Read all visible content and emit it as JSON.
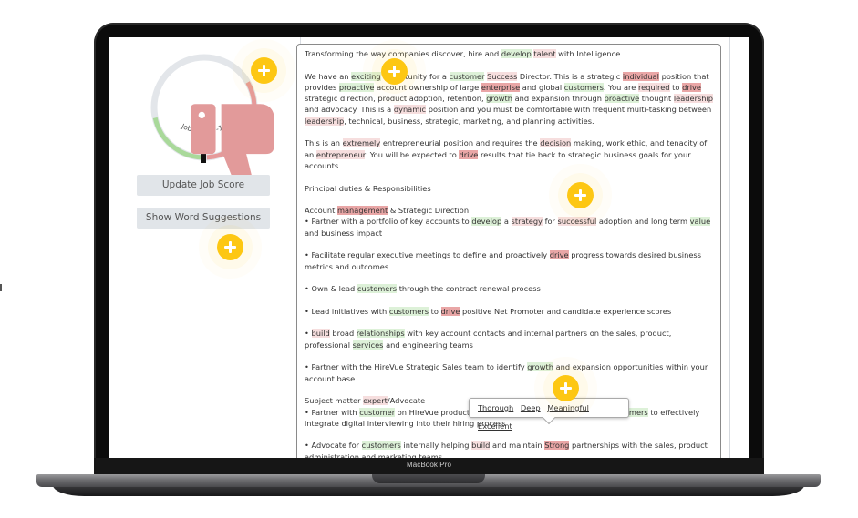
{
  "device": {
    "label": "MacBook Pro"
  },
  "score_panel": {
    "score_label": "Job Score: -12",
    "score_value": -12,
    "sentiment_icon": "thumbs-down-icon",
    "gauge": {
      "positive_color": "#a9d99a",
      "negative_color": "#e69a9a",
      "track_color": "#e3e6ea",
      "marker_color": "#111111"
    },
    "update_button": "Update Job Score",
    "suggest_button": "Show Word Suggestions"
  },
  "colors": {
    "positive_highlight": "#ddf1d8",
    "negative_highlight": "#f6dede",
    "strong_negative_highlight": "#e9a6a6",
    "hotspot": "#fdc713"
  },
  "document": {
    "paragraphs": [
      [
        [
          "Transforming the way companies discover, hire and ",
          ""
        ],
        [
          "develop",
          "g"
        ],
        [
          " ",
          ""
        ],
        [
          "talent",
          "r"
        ],
        [
          " with Intelligence.",
          ""
        ]
      ],
      [
        [
          "We have an ",
          ""
        ],
        [
          "exciting",
          "g"
        ],
        [
          " opportunity for a ",
          ""
        ],
        [
          "customer",
          "g"
        ],
        [
          " ",
          ""
        ],
        [
          "Success",
          "r"
        ],
        [
          " Director. This is a strategic ",
          ""
        ],
        [
          "individual",
          "rd"
        ],
        [
          " position that provides ",
          ""
        ],
        [
          "proactive",
          "g"
        ],
        [
          " account ownership of large ",
          ""
        ],
        [
          "enterprise",
          "rd"
        ],
        [
          " and global ",
          ""
        ],
        [
          "customers",
          "g"
        ],
        [
          ". You are ",
          ""
        ],
        [
          "required",
          "r"
        ],
        [
          " to ",
          ""
        ],
        [
          "drive",
          "rd"
        ],
        [
          " strategic direction, product adoption, retention, ",
          ""
        ],
        [
          "growth",
          "g"
        ],
        [
          " and expansion through ",
          ""
        ],
        [
          "proactive",
          "g"
        ],
        [
          " thought ",
          ""
        ],
        [
          "leadership",
          "r"
        ],
        [
          " and advocacy. This is a ",
          ""
        ],
        [
          "dynamic",
          "r"
        ],
        [
          " position and you must be comfortable with frequent multi-tasking between ",
          ""
        ],
        [
          "leadership",
          "r"
        ],
        [
          ", technical, business, strategic, marketing, and planning activities.",
          ""
        ]
      ],
      [
        [
          "This is an ",
          ""
        ],
        [
          "extremely",
          "r"
        ],
        [
          " entrepreneurial position and requires the ",
          ""
        ],
        [
          "decision",
          "r"
        ],
        [
          " making, work ethic, and tenacity of an ",
          ""
        ],
        [
          "entrepreneur",
          "r"
        ],
        [
          ". You will be expected to ",
          ""
        ],
        [
          "drive",
          "rd"
        ],
        [
          " results that tie back to strategic business goals for your accounts.",
          ""
        ]
      ],
      [
        [
          "Principal duties & Responsibilities",
          ""
        ]
      ],
      [
        [
          "Account ",
          ""
        ],
        [
          "management",
          "rd"
        ],
        [
          " & Strategic Direction\n• Partner with a portfolio of key accounts to ",
          ""
        ],
        [
          "develop",
          "g"
        ],
        [
          " a ",
          ""
        ],
        [
          "strategy",
          "r"
        ],
        [
          " for ",
          ""
        ],
        [
          "successful",
          "r"
        ],
        [
          " adoption and long term ",
          ""
        ],
        [
          "value",
          "g"
        ],
        [
          " and business impact",
          ""
        ]
      ],
      [
        [
          "• Facilitate regular executive meetings to define and proactively ",
          ""
        ],
        [
          "drive",
          "rd"
        ],
        [
          " progress towards desired business metrics and outcomes",
          ""
        ]
      ],
      [
        [
          "• Own & lead ",
          ""
        ],
        [
          "customers",
          "g"
        ],
        [
          " through the contract renewal process",
          ""
        ]
      ],
      [
        [
          "• Lead initiatives with ",
          ""
        ],
        [
          "customers",
          "g"
        ],
        [
          " to ",
          ""
        ],
        [
          "drive",
          "rd"
        ],
        [
          " positive Net Promoter and candidate experience scores",
          ""
        ]
      ],
      [
        [
          "• ",
          ""
        ],
        [
          "build",
          "r"
        ],
        [
          " broad ",
          ""
        ],
        [
          "relationships",
          "g"
        ],
        [
          " with key account contacts and internal partners on the sales, product, professional ",
          ""
        ],
        [
          "services",
          "g"
        ],
        [
          " and engineering teams",
          ""
        ]
      ],
      [
        [
          "• Partner with the HireVue Strategic Sales team to identify ",
          ""
        ],
        [
          "growth",
          "g"
        ],
        [
          " and expansion opportunities within your account base.",
          ""
        ]
      ],
      [
        [
          "Subject matter ",
          ""
        ],
        [
          "expert",
          "r"
        ],
        [
          "/Advocate\n• Partner with ",
          ""
        ],
        [
          "customer",
          "g"
        ],
        [
          " on HireVue product roadmap and feedback to help lead ",
          ""
        ],
        [
          "customers",
          "g"
        ],
        [
          " to effectively integrate digital interviewing into their hiring process",
          ""
        ]
      ],
      [
        [
          "• Advocate for ",
          ""
        ],
        [
          "customers",
          "g"
        ],
        [
          " internally helping ",
          ""
        ],
        [
          "build",
          "r"
        ],
        [
          " and maintain ",
          ""
        ],
        [
          "Strong",
          "rd"
        ],
        [
          " partnerships with the sales, product administration and marketing teams",
          ""
        ]
      ]
    ]
  },
  "suggestions": {
    "target_word": "Strong",
    "options": [
      "Thorough",
      "Deep",
      "Meaningful",
      "Excellent"
    ]
  },
  "hotspots": [
    "hotspot-score",
    "hotspot-opportunity",
    "hotspot-suggestions-button",
    "hotspot-successful",
    "hotspot-tooltip"
  ]
}
